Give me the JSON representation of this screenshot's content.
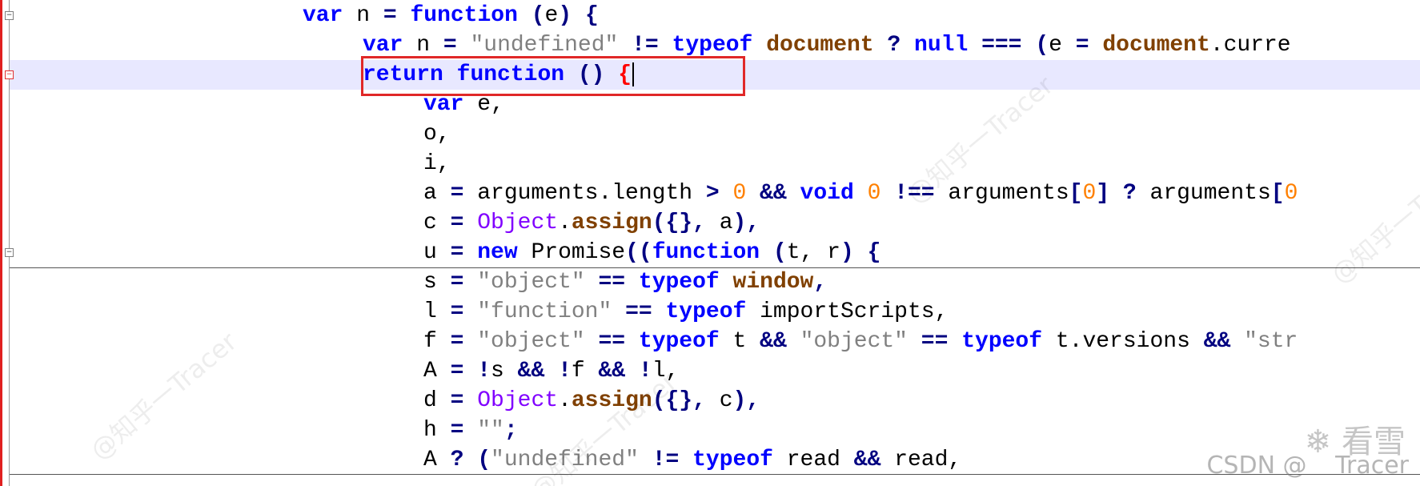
{
  "editor": {
    "lines": [
      {
        "segments": [
          {
            "t": "var",
            "c": "kw"
          },
          {
            "t": " n ",
            "c": "id"
          },
          {
            "t": "=",
            "c": "op"
          },
          {
            "t": " ",
            "c": "id"
          },
          {
            "t": "function",
            "c": "kw"
          },
          {
            "t": " ",
            "c": "id"
          },
          {
            "t": "(",
            "c": "op"
          },
          {
            "t": "e",
            "c": "id"
          },
          {
            "t": ")",
            "c": "op"
          },
          {
            "t": " ",
            "c": "id"
          },
          {
            "t": "{",
            "c": "op"
          }
        ]
      },
      {
        "segments": [
          {
            "t": "var",
            "c": "kw"
          },
          {
            "t": " n ",
            "c": "id"
          },
          {
            "t": "=",
            "c": "op"
          },
          {
            "t": " ",
            "c": "id"
          },
          {
            "t": "\"undefined\"",
            "c": "str"
          },
          {
            "t": " ",
            "c": "id"
          },
          {
            "t": "!=",
            "c": "op"
          },
          {
            "t": " ",
            "c": "id"
          },
          {
            "t": "typeof",
            "c": "kw"
          },
          {
            "t": " ",
            "c": "id"
          },
          {
            "t": "document",
            "c": "glob"
          },
          {
            "t": " ",
            "c": "id"
          },
          {
            "t": "?",
            "c": "op"
          },
          {
            "t": " ",
            "c": "id"
          },
          {
            "t": "null",
            "c": "kw"
          },
          {
            "t": " ",
            "c": "id"
          },
          {
            "t": "===",
            "c": "op"
          },
          {
            "t": " ",
            "c": "id"
          },
          {
            "t": "(",
            "c": "op"
          },
          {
            "t": "e ",
            "c": "id"
          },
          {
            "t": "=",
            "c": "op"
          },
          {
            "t": " ",
            "c": "id"
          },
          {
            "t": "document",
            "c": "glob"
          },
          {
            "t": ".curre",
            "c": "id"
          }
        ]
      },
      {
        "segments": [
          {
            "t": "return",
            "c": "kw"
          },
          {
            "t": " ",
            "c": "id"
          },
          {
            "t": "function",
            "c": "kw"
          },
          {
            "t": " ",
            "c": "id"
          },
          {
            "t": "()",
            "c": "op"
          },
          {
            "t": " ",
            "c": "id"
          },
          {
            "t": "{",
            "c": "brace-red"
          }
        ]
      },
      {
        "segments": [
          {
            "t": "var",
            "c": "kw"
          },
          {
            "t": " e,",
            "c": "id"
          }
        ]
      },
      {
        "segments": [
          {
            "t": "o,",
            "c": "id"
          }
        ]
      },
      {
        "segments": [
          {
            "t": "i,",
            "c": "id"
          }
        ]
      },
      {
        "segments": [
          {
            "t": "a ",
            "c": "id"
          },
          {
            "t": "=",
            "c": "op"
          },
          {
            "t": " arguments.length ",
            "c": "id"
          },
          {
            "t": ">",
            "c": "op"
          },
          {
            "t": " ",
            "c": "id"
          },
          {
            "t": "0",
            "c": "num"
          },
          {
            "t": " ",
            "c": "id"
          },
          {
            "t": "&&",
            "c": "op"
          },
          {
            "t": " ",
            "c": "id"
          },
          {
            "t": "void",
            "c": "kw"
          },
          {
            "t": " ",
            "c": "id"
          },
          {
            "t": "0",
            "c": "num"
          },
          {
            "t": " ",
            "c": "id"
          },
          {
            "t": "!==",
            "c": "op"
          },
          {
            "t": " arguments",
            "c": "id"
          },
          {
            "t": "[",
            "c": "op"
          },
          {
            "t": "0",
            "c": "num"
          },
          {
            "t": "]",
            "c": "op"
          },
          {
            "t": " ",
            "c": "id"
          },
          {
            "t": "?",
            "c": "op"
          },
          {
            "t": " arguments",
            "c": "id"
          },
          {
            "t": "[",
            "c": "op"
          },
          {
            "t": "0",
            "c": "num"
          }
        ]
      },
      {
        "segments": [
          {
            "t": "c ",
            "c": "id"
          },
          {
            "t": "=",
            "c": "op"
          },
          {
            "t": " ",
            "c": "id"
          },
          {
            "t": "Object",
            "c": "obj"
          },
          {
            "t": ".",
            "c": "id"
          },
          {
            "t": "assign",
            "c": "mth"
          },
          {
            "t": "({},",
            "c": "op"
          },
          {
            "t": " a",
            "c": "id"
          },
          {
            "t": "),",
            "c": "op"
          }
        ]
      },
      {
        "segments": [
          {
            "t": "u ",
            "c": "id"
          },
          {
            "t": "=",
            "c": "op"
          },
          {
            "t": " ",
            "c": "id"
          },
          {
            "t": "new",
            "c": "kw"
          },
          {
            "t": " Promise",
            "c": "id"
          },
          {
            "t": "((",
            "c": "op"
          },
          {
            "t": "function",
            "c": "kw"
          },
          {
            "t": " ",
            "c": "id"
          },
          {
            "t": "(",
            "c": "op"
          },
          {
            "t": "t, r",
            "c": "id"
          },
          {
            "t": ")",
            "c": "op"
          },
          {
            "t": " ",
            "c": "id"
          },
          {
            "t": "{",
            "c": "op"
          }
        ]
      },
      {
        "segments": [
          {
            "t": "s ",
            "c": "id"
          },
          {
            "t": "=",
            "c": "op"
          },
          {
            "t": " ",
            "c": "id"
          },
          {
            "t": "\"object\"",
            "c": "str"
          },
          {
            "t": " ",
            "c": "id"
          },
          {
            "t": "==",
            "c": "op"
          },
          {
            "t": " ",
            "c": "id"
          },
          {
            "t": "typeof",
            "c": "kw"
          },
          {
            "t": " ",
            "c": "id"
          },
          {
            "t": "window",
            "c": "glob"
          },
          {
            "t": ",",
            "c": "op"
          }
        ]
      },
      {
        "segments": [
          {
            "t": "l ",
            "c": "id"
          },
          {
            "t": "=",
            "c": "op"
          },
          {
            "t": " ",
            "c": "id"
          },
          {
            "t": "\"function\"",
            "c": "str"
          },
          {
            "t": " ",
            "c": "id"
          },
          {
            "t": "==",
            "c": "op"
          },
          {
            "t": " ",
            "c": "id"
          },
          {
            "t": "typeof",
            "c": "kw"
          },
          {
            "t": " importScripts,",
            "c": "id"
          }
        ]
      },
      {
        "segments": [
          {
            "t": "f ",
            "c": "id"
          },
          {
            "t": "=",
            "c": "op"
          },
          {
            "t": " ",
            "c": "id"
          },
          {
            "t": "\"object\"",
            "c": "str"
          },
          {
            "t": " ",
            "c": "id"
          },
          {
            "t": "==",
            "c": "op"
          },
          {
            "t": " ",
            "c": "id"
          },
          {
            "t": "typeof",
            "c": "kw"
          },
          {
            "t": " t ",
            "c": "id"
          },
          {
            "t": "&&",
            "c": "op"
          },
          {
            "t": " ",
            "c": "id"
          },
          {
            "t": "\"object\"",
            "c": "str"
          },
          {
            "t": " ",
            "c": "id"
          },
          {
            "t": "==",
            "c": "op"
          },
          {
            "t": " ",
            "c": "id"
          },
          {
            "t": "typeof",
            "c": "kw"
          },
          {
            "t": " t.versions ",
            "c": "id"
          },
          {
            "t": "&&",
            "c": "op"
          },
          {
            "t": " ",
            "c": "id"
          },
          {
            "t": "\"str",
            "c": "str"
          }
        ]
      },
      {
        "segments": [
          {
            "t": "A ",
            "c": "id"
          },
          {
            "t": "=",
            "c": "op"
          },
          {
            "t": " ",
            "c": "id"
          },
          {
            "t": "!",
            "c": "op"
          },
          {
            "t": "s ",
            "c": "id"
          },
          {
            "t": "&&",
            "c": "op"
          },
          {
            "t": " ",
            "c": "id"
          },
          {
            "t": "!",
            "c": "op"
          },
          {
            "t": "f ",
            "c": "id"
          },
          {
            "t": "&&",
            "c": "op"
          },
          {
            "t": " ",
            "c": "id"
          },
          {
            "t": "!",
            "c": "op"
          },
          {
            "t": "l,",
            "c": "id"
          }
        ]
      },
      {
        "segments": [
          {
            "t": "d ",
            "c": "id"
          },
          {
            "t": "=",
            "c": "op"
          },
          {
            "t": " ",
            "c": "id"
          },
          {
            "t": "Object",
            "c": "obj"
          },
          {
            "t": ".",
            "c": "id"
          },
          {
            "t": "assign",
            "c": "mth"
          },
          {
            "t": "({},",
            "c": "op"
          },
          {
            "t": " c",
            "c": "id"
          },
          {
            "t": "),",
            "c": "op"
          }
        ]
      },
      {
        "segments": [
          {
            "t": "h ",
            "c": "id"
          },
          {
            "t": "=",
            "c": "op"
          },
          {
            "t": " ",
            "c": "id"
          },
          {
            "t": "\"\"",
            "c": "str"
          },
          {
            "t": ";",
            "c": "op"
          }
        ]
      },
      {
        "segments": [
          {
            "t": "A ",
            "c": "id"
          },
          {
            "t": "?",
            "c": "op"
          },
          {
            "t": " ",
            "c": "id"
          },
          {
            "t": "(",
            "c": "op"
          },
          {
            "t": "\"undefined\"",
            "c": "str"
          },
          {
            "t": " ",
            "c": "id"
          },
          {
            "t": "!=",
            "c": "op"
          },
          {
            "t": " ",
            "c": "id"
          },
          {
            "t": "typeof",
            "c": "kw"
          },
          {
            "t": " read ",
            "c": "id"
          },
          {
            "t": "&&",
            "c": "op"
          },
          {
            "t": " read,",
            "c": "id"
          }
        ]
      }
    ]
  },
  "watermarks": {
    "zhihu": "@知乎一Tracer",
    "csdn": "CSDN @",
    "kanxue": "看雪",
    "tracer": "Tracer"
  }
}
